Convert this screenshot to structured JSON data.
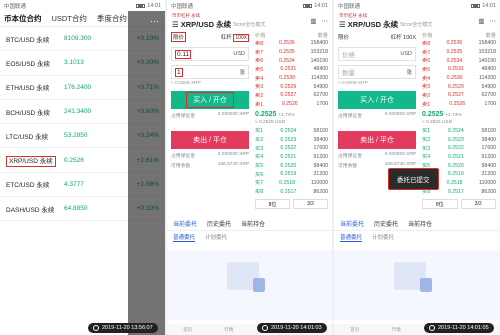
{
  "status": {
    "carrier": "中国联通",
    "p1_time": "14:01",
    "p2_time": "14:01",
    "p3_time": "14:01"
  },
  "p1": {
    "tabs": [
      "币本位合约",
      "USDT合约",
      "季度合约"
    ],
    "rows": [
      {
        "pair": "BTC/USD 永续",
        "price": "8109.300",
        "change": "+0.10%"
      },
      {
        "pair": "EOS/USD 永续",
        "price": "3.1013",
        "change": "+0.30%"
      },
      {
        "pair": "ETH/USD 永续",
        "price": "176.2400",
        "change": "+0.71%"
      },
      {
        "pair": "BCH/USD 永续",
        "price": "241.3400",
        "change": "+0.60%"
      },
      {
        "pair": "LTC/USD 永续",
        "price": "53.2850",
        "change": "+0.24%"
      },
      {
        "pair": "XRP/USD 永续",
        "price": "0.2526",
        "change": "+1.61%"
      },
      {
        "pair": "ETC/USD 永续",
        "price": "4.3777",
        "change": "+1.08%"
      },
      {
        "pair": "DASH/USD 永续",
        "price": "64.8850",
        "change": "+0.10%"
      }
    ],
    "overlay_menu": "···",
    "stamp": "2019-11-20 13:56:07"
  },
  "trade": {
    "subtitle": "币币杠杆 永续",
    "title": "XRP/USD 永续",
    "title_tag": "5tcon全仓模式",
    "mode": "限价",
    "leverage_label": "杠杆",
    "leverage": "100X",
    "unit_usd": "USD",
    "unit_zhang": "张",
    "hint": "≈ 0.0006 XRP",
    "buy_label": "买入 / 开仓",
    "sell_label": "卖出 / 平仓",
    "meta_rows": [
      [
        "占用保证金",
        "0.000000 XRP"
      ],
      [
        "可用余额",
        "106.5740 XRP"
      ]
    ],
    "book_headers": [
      "价格",
      "数量"
    ],
    "book_asks": [
      {
        "lvl": "卖8",
        "price": "0.2536",
        "qty": "158400"
      },
      {
        "lvl": "卖7",
        "price": "0.2535",
        "qty": "103218"
      },
      {
        "lvl": "卖6",
        "price": "0.2534",
        "qty": "140190"
      },
      {
        "lvl": "卖5",
        "price": "0.2531",
        "qty": "48400"
      },
      {
        "lvl": "卖4",
        "price": "0.2530",
        "qty": "114200"
      },
      {
        "lvl": "卖3",
        "price": "0.2529",
        "qty": "54900"
      },
      {
        "lvl": "卖2",
        "price": "0.2527",
        "qty": "62700"
      },
      {
        "lvl": "卖1",
        "price": "0.2526",
        "qty": "1700"
      }
    ],
    "mid_price": "0.2525",
    "mid_change": "+1.74%",
    "mid_sub": "≈ 0.2525 USD",
    "book_bids": [
      {
        "lvl": "买1",
        "price": "0.2524",
        "qty": "58100"
      },
      {
        "lvl": "买2",
        "price": "0.2523",
        "qty": "38400"
      },
      {
        "lvl": "买3",
        "price": "0.2522",
        "qty": "17600"
      },
      {
        "lvl": "买4",
        "price": "0.2521",
        "qty": "51200"
      },
      {
        "lvl": "买5",
        "price": "0.2520",
        "qty": "98400"
      },
      {
        "lvl": "买6",
        "price": "0.2519",
        "qty": "31200"
      },
      {
        "lvl": "买7",
        "price": "0.2518",
        "qty": "110000"
      },
      {
        "lvl": "买8",
        "price": "0.2517",
        "qty": "86200"
      }
    ],
    "depth_label": "8位",
    "depth_alt": "3/2",
    "order_tabs": [
      "当前委托",
      "历史委托",
      "当前持仓"
    ],
    "sub_tabs": [
      "普通委托",
      "计划委托"
    ],
    "nav": [
      "首页",
      "行情",
      "交易",
      "资产"
    ]
  },
  "p2": {
    "price_value": "0.11",
    "qty_value": "1",
    "stamp": "2019-11-20 14:01:03"
  },
  "p3": {
    "price_placeholder": "价格",
    "qty_placeholder": "数量",
    "toast": "委托已提交",
    "stamp": "2019-11-20 14:01:05"
  }
}
